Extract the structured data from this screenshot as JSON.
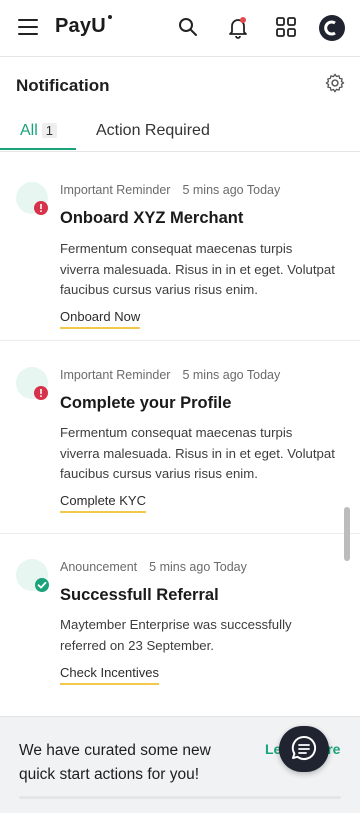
{
  "app": {
    "brand": "PayU",
    "brand_prefix": "Pay",
    "brand_suffix": "U"
  },
  "topbar": {
    "icons": [
      "menu-icon",
      "search-icon",
      "bell-icon",
      "apps-grid-icon",
      "avatar"
    ]
  },
  "page": {
    "title": "Notification"
  },
  "tabs": [
    {
      "label": "All",
      "count": "1",
      "active": true
    },
    {
      "label": "Action Required",
      "active": false
    }
  ],
  "notifications": [
    {
      "category": "Important Reminder",
      "time": "5 mins ago Today",
      "title": "Onboard XYZ Merchant",
      "body": "Fermentum consequat maecenas turpis viverra malesuada. Risus in in et eget. Volutpat faucibus cursus varius risus enim.",
      "action": "Onboard Now",
      "badge": "alert"
    },
    {
      "category": "Important Reminder",
      "time": "5 mins ago Today",
      "title": "Complete your Profile",
      "body": "Fermentum consequat maecenas turpis viverra malesuada. Risus in in et eget. Volutpat faucibus cursus varius risus enim.",
      "action": "Complete KYC",
      "badge": "alert"
    },
    {
      "category": "Anouncement",
      "time": "5 mins ago Today",
      "title": "Successfull Referral",
      "body": "Maytember Enterprise was successfully referred on 23 September.",
      "action": "Check Incentives",
      "badge": "success"
    }
  ],
  "banner": {
    "text": "We have curated some new quick start actions for you!",
    "link": "Learn More"
  },
  "colors": {
    "accent": "#1aa37a",
    "alert": "#d6334a",
    "link_underline": "#f2c94c",
    "dark": "#1f2430"
  }
}
